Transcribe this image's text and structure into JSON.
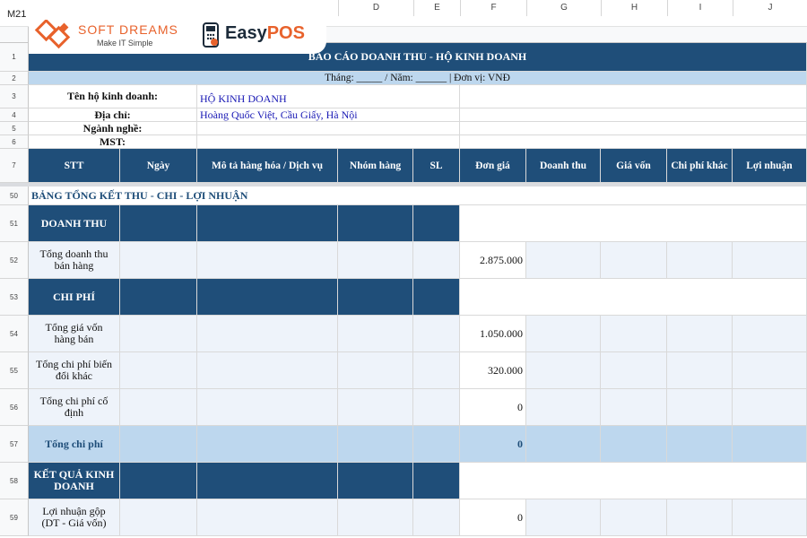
{
  "name_box": "M21",
  "logos": {
    "softdreams_name": "SOFT DREAMS",
    "softdreams_tagline": "Make IT Simple",
    "easypos_easy": "Easy",
    "easypos_pos": "POS"
  },
  "columns": [
    "D",
    "E",
    "F",
    "G",
    "H",
    "I",
    "J"
  ],
  "rows": [
    "1",
    "2",
    "3",
    "4",
    "5",
    "6",
    "7",
    "50",
    "51",
    "52",
    "53",
    "54",
    "55",
    "56",
    "57",
    "58",
    "59"
  ],
  "report": {
    "title": "BÁO CÁO DOANH THU - HỘ KINH DOANH",
    "period_line": "Tháng: _____  /  Năm: ______     |     Đơn vị: VNĐ",
    "info_labels": [
      "Tên hộ kinh doanh:",
      "Địa chỉ:",
      "Ngành nghề:",
      "MST:"
    ],
    "info_values": [
      "HỘ KINH DOANH",
      "Hoàng Quốc Việt, Cầu Giấy, Hà Nội",
      "",
      ""
    ],
    "table_headers": [
      "STT",
      "Ngày",
      "Mô tả hàng hóa / Dịch vụ",
      "Nhóm hàng",
      "SL",
      "Đơn giá",
      "Doanh thu",
      "Giá vốn",
      "Chi phí khác",
      "Lợi nhuận"
    ]
  },
  "summary": {
    "title": "BẢNG TỔNG KẾT  THU - CHI - LỢI NHUẬN",
    "sections": {
      "revenue": "DOANH THU",
      "cost": "CHI PHÍ",
      "result": "KẾT QUẢ KINH DOANH"
    },
    "lines": [
      {
        "label": "Tổng doanh thu bán hàng",
        "value": "2.875.000"
      },
      {
        "label": "Tổng giá vốn hàng bán",
        "value": "1.050.000"
      },
      {
        "label": "Tổng chi phí biến đổi khác",
        "value": "320.000"
      },
      {
        "label": "Tổng chi phí cố định",
        "value": "0"
      },
      {
        "label": "Tổng chi phí",
        "value": "0"
      },
      {
        "label": "Lợi nhuận gộp (DT - Giá vốn)",
        "value": "0"
      }
    ]
  },
  "colors": {
    "header_dark": "#1f4e79",
    "row_light": "#eef3fa",
    "total_row": "#bdd7ee",
    "brand_orange": "#e8622c"
  }
}
